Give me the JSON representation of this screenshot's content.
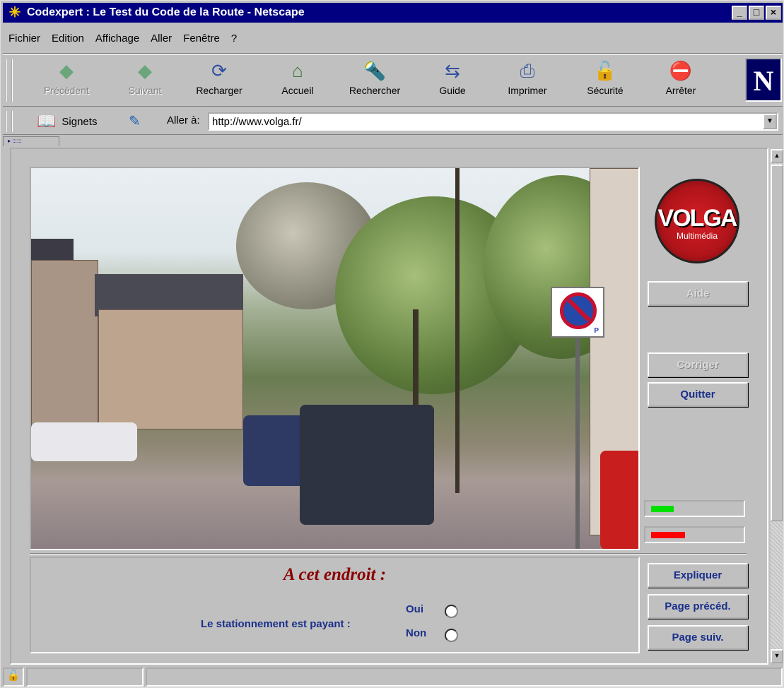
{
  "window": {
    "title": "Codexpert : Le Test du Code de la Route - Netscape",
    "controls": [
      "_",
      "□",
      "×"
    ]
  },
  "menu": [
    {
      "label": "Fichier",
      "accel": "F"
    },
    {
      "label": "Edition",
      "accel": "E"
    },
    {
      "label": "Affichage",
      "accel": "A"
    },
    {
      "label": "Aller",
      "accel": "l"
    },
    {
      "label": "Fenêtre",
      "accel": "n"
    },
    {
      "label": "?",
      "accel": "?"
    }
  ],
  "toolbar": {
    "buttons": [
      {
        "label": "Précédent",
        "icon": "back-arrow-icon",
        "enabled": false
      },
      {
        "label": "Suivant",
        "icon": "forward-arrow-icon",
        "enabled": false
      },
      {
        "label": "Recharger",
        "icon": "reload-icon",
        "enabled": true
      },
      {
        "label": "Accueil",
        "icon": "home-icon",
        "enabled": true
      },
      {
        "label": "Rechercher",
        "icon": "search-icon",
        "enabled": true
      },
      {
        "label": "Guide",
        "icon": "guide-icon",
        "enabled": true
      },
      {
        "label": "Imprimer",
        "icon": "printer-icon",
        "enabled": true
      },
      {
        "label": "Sécurité",
        "icon": "lock-icon",
        "enabled": true
      },
      {
        "label": "Arrêter",
        "icon": "stop-light-icon",
        "enabled": true
      }
    ],
    "brand_logo": "N"
  },
  "location": {
    "bookmarks_label": "Signets",
    "goto_label": "Aller à:",
    "url": "http://www.volga.fr/"
  },
  "app": {
    "logo_text": "VOLGA",
    "logo_sub": "Multimédia",
    "buttons": {
      "aide": "Aide",
      "corriger": "Corriger",
      "quitter": "Quitter",
      "expliquer": "Expliquer",
      "page_prec": "Page précéd.",
      "page_suiv": "Page suiv."
    },
    "progress": {
      "green": 0.25,
      "red": 0.38,
      "green_color": "#00e000",
      "red_color": "#ff0000"
    },
    "question": {
      "title": "A cet endroit :",
      "text": "Le stationnement est payant :",
      "options": [
        "Oui",
        "Non"
      ]
    }
  },
  "colors": {
    "titlebar": "#000080",
    "app_text": "#1a2f8a",
    "question_title": "#8b0000"
  }
}
